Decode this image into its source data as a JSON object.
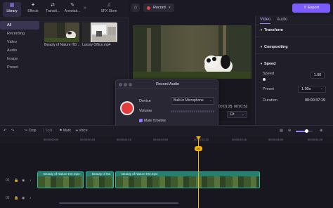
{
  "library_tabs": [
    {
      "label": "Library",
      "icon": "library-icon"
    },
    {
      "label": "Effects",
      "icon": "effects-icon"
    },
    {
      "label": "Transiti...",
      "icon": "transitions-icon"
    },
    {
      "label": "Annotati...",
      "icon": "annotations-icon"
    },
    {
      "label": "SFX Store",
      "icon": "sfx-store-icon"
    }
  ],
  "sidebar": [
    "All",
    "Recording",
    "Video",
    "Audio",
    "Image",
    "Preset"
  ],
  "media": [
    {
      "label": "Beauty of Nature HD...",
      "selected": true
    },
    {
      "label": "Luxury Office.mp4",
      "selected": false
    }
  ],
  "header": {
    "record": "Record",
    "export": "Export"
  },
  "preview": {
    "time_current": "00:01:25",
    "time_total": "00:01:52",
    "fit": "Fit"
  },
  "inspector": {
    "tabs": [
      "Video",
      "Audio"
    ],
    "sections": [
      "Transform",
      "Compositing",
      "Speed"
    ],
    "speed_label": "Speed",
    "speed_value": "1.00",
    "preset_label": "Preset",
    "preset_value": "1.00x",
    "duration_label": "Duration",
    "duration_value": "00:00:37:19"
  },
  "dialog": {
    "title": "Record Audio",
    "device_label": "Device",
    "device_value": "Built-in Microphone",
    "volume_label": "Volume",
    "mute_label": "Mute Timeline",
    "mute_checked": true
  },
  "timeline_toolbar": [
    "Crop",
    "Split",
    "Mark",
    "Voice"
  ],
  "ruler": [
    "00:00:00:00",
    "00:00:00:20",
    "00:00:01:10",
    "00:00:02:00",
    "00:00:02:20",
    "00:00:03:10",
    "00:00:04:00",
    "00:00:04:20"
  ],
  "playhead_label": "00",
  "clips": [
    {
      "label": "Beauty of Nature HD.mp4"
    },
    {
      "label": "Beauty of Na"
    },
    {
      "label": "Beauty of Nature HD.mp4"
    }
  ],
  "colors": {
    "accent": "#7d5cff",
    "record": "#e43b3b",
    "playhead": "#f5b400",
    "clip": "#3ab6a0"
  }
}
